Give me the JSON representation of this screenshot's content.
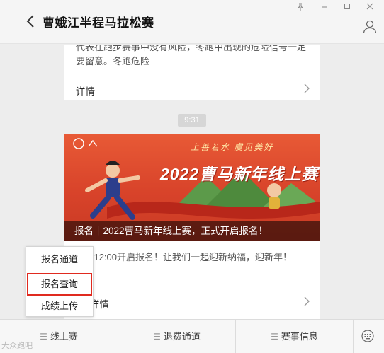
{
  "header": {
    "title": "曹娥江半程马拉松赛",
    "back_icon": "chevron-left-icon",
    "pin_icon": "pin-icon",
    "minimize_icon": "minimize-icon",
    "maximize_icon": "maximize-icon",
    "close_icon": "close-icon",
    "profile_icon": "user-icon"
  },
  "messages": {
    "card1": {
      "text": "代表在跑步赛事中没有风险，冬跑中出现的危险信号一定要留意。冬跑危险",
      "detail_label": "详情"
    },
    "timestamp": "9:31",
    "card2": {
      "banner_slogan": "上善若水 虞见美好",
      "banner_headline": "2022曹马新年线上赛",
      "banner_caption": "报名｜2022曹马新年线上赛，正式开启报名！",
      "text": "15日12:00开启报名！让我们一起迎新纳福，迎新年！",
      "detail_label": "详情"
    }
  },
  "popup_menu": {
    "items": [
      "报名通道",
      "报名查询",
      "成绩上传"
    ],
    "highlighted_index": 1,
    "highlight_color": "#e02a1f"
  },
  "bottom_menu": {
    "tabs": [
      "线上赛",
      "退费通道",
      "赛事信息"
    ],
    "keyboard_icon": "keyboard-icon"
  },
  "watermark": "大众跑吧"
}
